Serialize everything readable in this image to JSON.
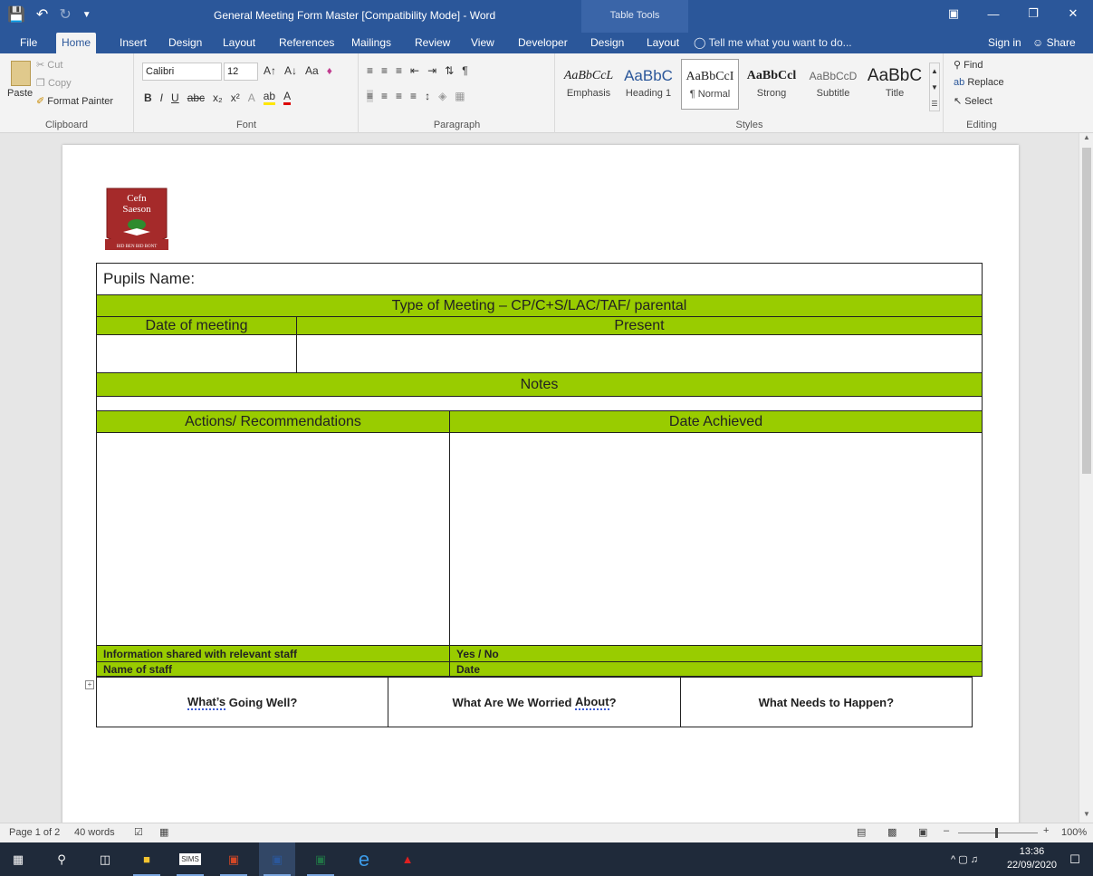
{
  "window": {
    "title": "General Meeting Form Master [Compatibility Mode] - Word",
    "context_tab_group": "Table Tools",
    "minimize_glyph": "—",
    "restore_glyph": "❐",
    "close_glyph": "✕"
  },
  "qat": {
    "save_icon": "save-icon",
    "undo_icon": "undo-icon",
    "redo_icon": "redo-icon"
  },
  "tabs": [
    {
      "label": "File"
    },
    {
      "label": "Home"
    },
    {
      "label": "Insert"
    },
    {
      "label": "Design"
    },
    {
      "label": "Layout"
    },
    {
      "label": "References"
    },
    {
      "label": "Mailings"
    },
    {
      "label": "Review"
    },
    {
      "label": "View"
    },
    {
      "label": "Developer"
    },
    {
      "label": "Design"
    },
    {
      "label": "Layout"
    }
  ],
  "tell_me": "Tell me what you want to do...",
  "sign_in": "Sign in",
  "share": "Share",
  "ribbon": {
    "clipboard": {
      "paste": "Paste",
      "cut": "Cut",
      "copy": "Copy",
      "format_painter": "Format Painter",
      "label": "Clipboard"
    },
    "font": {
      "family": "Calibri",
      "size": "12",
      "label": "Font"
    },
    "paragraph": {
      "label": "Paragraph"
    },
    "styles": {
      "label": "Styles",
      "items": [
        {
          "preview": "AaBbCcL",
          "name": "Emphasis"
        },
        {
          "preview": "AaBbC",
          "name": "Heading 1"
        },
        {
          "preview": "AaBbCcI",
          "name": "¶ Normal"
        },
        {
          "preview": "AaBbCcl",
          "name": "Strong"
        },
        {
          "preview": "AaBbCcD",
          "name": "Subtitle"
        },
        {
          "preview": "AaBbC",
          "name": "Title"
        }
      ]
    },
    "editing": {
      "find": "Find",
      "replace": "Replace",
      "select": "Select",
      "label": "Editing"
    }
  },
  "document": {
    "logo": {
      "line1": "Cefn",
      "line2": "Saeson",
      "motto": "BID BEN BID BONT"
    },
    "pupils_name": "Pupils Name:",
    "type_of_meeting": "Type of Meeting – CP/C+S/LAC/TAF/ parental",
    "date_of_meeting": "Date of meeting",
    "present": "Present",
    "notes": "Notes",
    "actions": "Actions/ Recommendations",
    "date_achieved": "Date Achieved",
    "info_shared": "Information  shared with  relevant staff",
    "yes_no": "Yes  /  No",
    "name_of_staff": "Name of staff",
    "date": "Date",
    "going_well_pre": "What’s",
    "going_well_post": " Going Well?",
    "worried_pre": "What Are We Worried ",
    "worried_word": "About",
    "worried_post": "?",
    "needs": "What Needs to Happen?"
  },
  "status": {
    "page": "Page 1 of 2",
    "words": "40 words",
    "zoom": "100%"
  },
  "taskbar": {
    "time": "13:36",
    "date": "22/09/2020"
  },
  "colors": {
    "word_blue": "#2b579a",
    "table_green": "#99cc00"
  }
}
